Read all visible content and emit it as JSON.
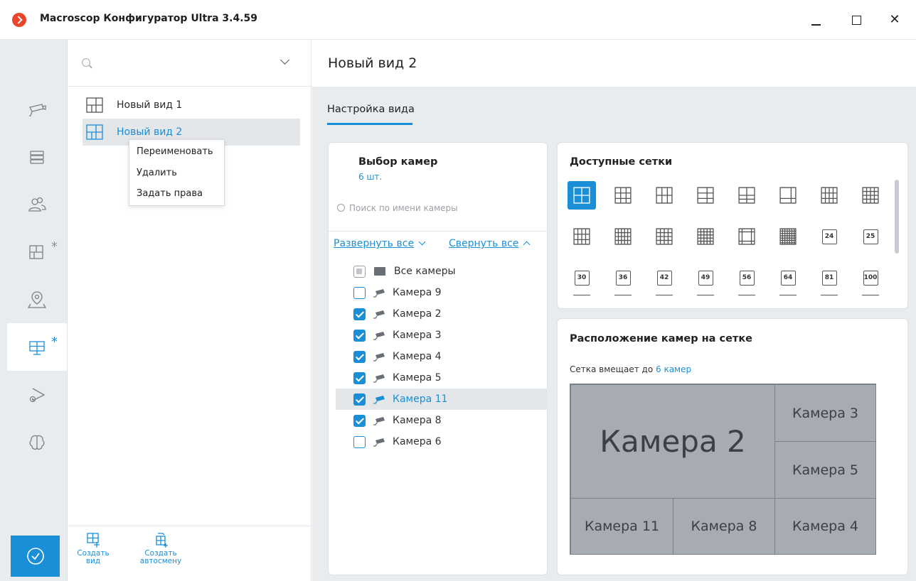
{
  "window": {
    "title": "Macroscop Конфигуратор Ultra 3.4.59",
    "minimize": "",
    "maximize": "",
    "close": "✕"
  },
  "rail": {
    "items": [
      {
        "name": "cameras",
        "icon": "camera-icon"
      },
      {
        "name": "servers",
        "icon": "server-icon"
      },
      {
        "name": "users",
        "icon": "users-icon"
      },
      {
        "name": "views",
        "icon": "layout-icon",
        "star": "*"
      },
      {
        "name": "maps",
        "icon": "map-pin-icon"
      },
      {
        "name": "monitors",
        "icon": "monitor-icon",
        "star": "*"
      },
      {
        "name": "camera-settings",
        "icon": "camera-gear-icon"
      },
      {
        "name": "analytics",
        "icon": "brain-icon"
      }
    ],
    "active": "monitors",
    "apply": {
      "icon": "check-circle-icon"
    }
  },
  "list": {
    "search": {
      "placeholder": ""
    },
    "views": [
      {
        "label": "Новый вид 1",
        "selected": false
      },
      {
        "label": "Новый вид 2",
        "selected": true
      }
    ],
    "context_menu": [
      "Переименовать",
      "Удалить",
      "Задать права"
    ],
    "bottom": {
      "create_view": "Создать вид",
      "create_view_l1": "Создать",
      "create_view_l2": "вид",
      "create_auto_l1": "Создать",
      "create_auto_l2": "автосмену"
    }
  },
  "main": {
    "title": "Новый вид 2",
    "tab": "Настройка вида",
    "cameras_card": {
      "title": "Выбор камер",
      "count": "6 шт.",
      "search_placeholder": "Поиск по имени камеры",
      "expand_all": "Развернуть все",
      "collapse_all": "Свернуть все",
      "root": "Все камеры",
      "cameras": [
        {
          "label": "Камера 9",
          "checked": false
        },
        {
          "label": "Камера 2",
          "checked": true
        },
        {
          "label": "Камера 3",
          "checked": true
        },
        {
          "label": "Камера 4",
          "checked": true
        },
        {
          "label": "Камера 5",
          "checked": true
        },
        {
          "label": "Камера 11",
          "checked": true,
          "highlight": true
        },
        {
          "label": "Камера 8",
          "checked": true
        },
        {
          "label": "Камера 6",
          "checked": false
        }
      ]
    },
    "grids_card": {
      "title": "Доступные сетки",
      "numbered": [
        "24",
        "25",
        "30",
        "36",
        "42",
        "49",
        "56",
        "64",
        "81",
        "100"
      ]
    },
    "layout_card": {
      "title": "Расположение камер на сетке",
      "caption_prefix": "Сетка вмещает до",
      "caption_value": "6 камер",
      "cells": {
        "big": "Камера 2",
        "top_right": "Камера 3",
        "mid_right": "Камера 5",
        "bottom_left": "Камера 11",
        "bottom_mid": "Камера 8",
        "bottom_right": "Камера 4"
      }
    }
  },
  "colors": {
    "accent": "#1a8fd8",
    "rail_bg": "#e9ecef",
    "layout_cell": "#a7abb2",
    "logo": "#e8452a"
  }
}
